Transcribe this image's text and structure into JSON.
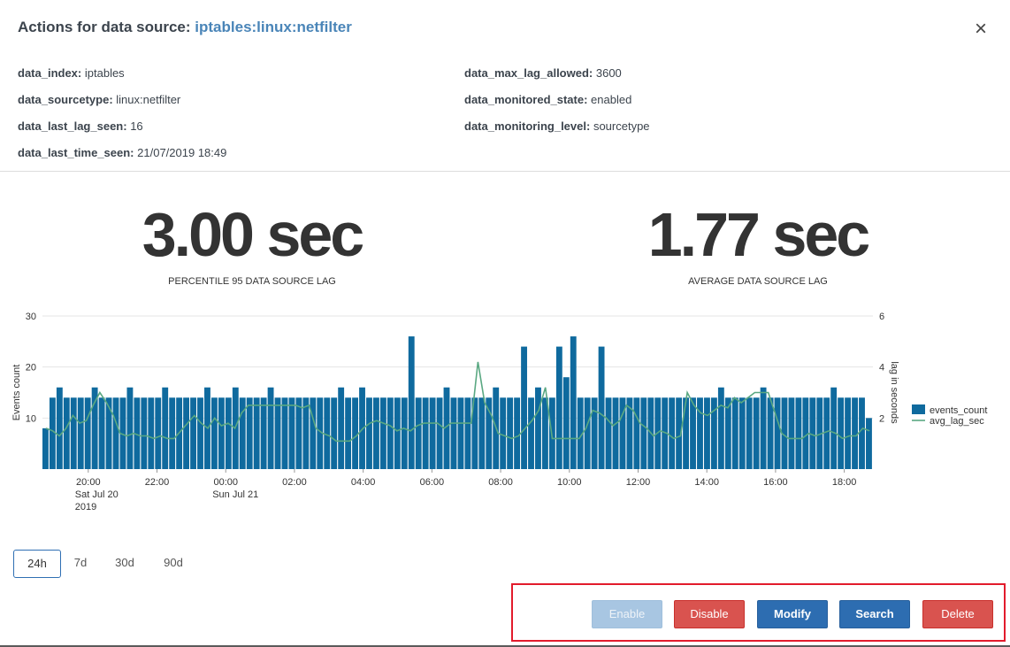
{
  "header": {
    "title_prefix": "Actions for data source:",
    "source_name": "iptables:linux:netfilter",
    "close_glyph": "×"
  },
  "details": {
    "left": [
      {
        "key": "data_index:",
        "value": "iptables"
      },
      {
        "key": "data_sourcetype:",
        "value": "linux:netfilter"
      },
      {
        "key": "data_last_lag_seen:",
        "value": "16"
      },
      {
        "key": "data_last_time_seen:",
        "value": "21/07/2019 18:49"
      }
    ],
    "right": [
      {
        "key": "data_max_lag_allowed:",
        "value": "3600"
      },
      {
        "key": "data_monitored_state:",
        "value": "enabled"
      },
      {
        "key": "data_monitoring_level:",
        "value": "sourcetype"
      }
    ]
  },
  "kpis": [
    {
      "value": "3.00 sec",
      "label": "PERCENTILE 95 DATA SOURCE LAG"
    },
    {
      "value": "1.77 sec",
      "label": "AVERAGE DATA SOURCE LAG"
    }
  ],
  "chart_data": {
    "type": "bar",
    "x_tick_labels": [
      [
        "20:00",
        "Sat Jul 20",
        "2019"
      ],
      [
        "22:00"
      ],
      [
        "00:00",
        "Sun Jul 21"
      ],
      [
        "02:00"
      ],
      [
        "04:00"
      ],
      [
        "06:00"
      ],
      [
        "08:00"
      ],
      [
        "10:00"
      ],
      [
        "12:00"
      ],
      [
        "14:00"
      ],
      [
        "16:00"
      ],
      [
        "18:00"
      ]
    ],
    "x_start": "2019-07-20 18:40",
    "x_end": "2019-07-21 18:50",
    "ylabel": "Events count",
    "y2label": "lag in seconds",
    "ylim": [
      0,
      30
    ],
    "y2lim": [
      0,
      6
    ],
    "yticks": [
      10,
      20,
      30
    ],
    "y2ticks": [
      2,
      4,
      6
    ],
    "grid": true,
    "legend_position": "right",
    "series": [
      {
        "name": "events_count",
        "type": "bar",
        "axis": "left",
        "color": "#0f6a9e",
        "values": [
          8,
          14,
          16,
          14,
          14,
          14,
          14,
          16,
          14,
          14,
          14,
          14,
          16,
          14,
          14,
          14,
          14,
          16,
          14,
          14,
          14,
          14,
          14,
          16,
          14,
          14,
          14,
          16,
          14,
          14,
          14,
          14,
          16,
          14,
          14,
          14,
          14,
          14,
          14,
          14,
          14,
          14,
          16,
          14,
          14,
          16,
          14,
          14,
          14,
          14,
          14,
          14,
          26,
          14,
          14,
          14,
          14,
          16,
          14,
          14,
          14,
          14,
          14,
          14,
          16,
          14,
          14,
          14,
          24,
          14,
          16,
          14,
          14,
          24,
          18,
          26,
          14,
          14,
          14,
          24,
          14,
          14,
          14,
          14,
          14,
          14,
          14,
          14,
          14,
          14,
          14,
          14,
          14,
          14,
          14,
          14,
          16,
          14,
          14,
          14,
          14,
          14,
          16,
          14,
          14,
          14,
          14,
          14,
          14,
          14,
          14,
          14,
          16,
          14,
          14,
          14,
          14,
          10
        ]
      },
      {
        "name": "avg_lag_sec",
        "type": "line",
        "axis": "right",
        "color": "#5aa882",
        "values": [
          1.6,
          1.5,
          1.3,
          1.6,
          2.1,
          1.8,
          1.9,
          2.5,
          3.0,
          2.6,
          2.1,
          1.4,
          1.3,
          1.4,
          1.3,
          1.3,
          1.2,
          1.3,
          1.2,
          1.2,
          1.5,
          1.8,
          2.1,
          1.8,
          1.6,
          2.0,
          1.7,
          1.8,
          1.6,
          2.2,
          2.5,
          2.5,
          2.5,
          2.5,
          2.5,
          2.5,
          2.5,
          2.5,
          2.4,
          2.5,
          1.6,
          1.4,
          1.3,
          1.1,
          1.1,
          1.1,
          1.3,
          1.6,
          1.8,
          1.9,
          1.8,
          1.7,
          1.5,
          1.6,
          1.5,
          1.7,
          1.8,
          1.8,
          1.8,
          1.6,
          1.8,
          1.8,
          1.8,
          1.8,
          4.2,
          2.6,
          2.1,
          1.4,
          1.3,
          1.2,
          1.3,
          1.6,
          1.9,
          2.3,
          3.2,
          1.2,
          1.2,
          1.2,
          1.2,
          1.2,
          1.6,
          2.3,
          2.2,
          2.0,
          1.7,
          1.9,
          2.5,
          2.3,
          1.8,
          1.6,
          1.3,
          1.5,
          1.4,
          1.2,
          1.3,
          3.0,
          2.5,
          2.2,
          2.1,
          2.3,
          2.5,
          2.4,
          2.8,
          2.6,
          2.8,
          3.0,
          3.0,
          3.0,
          2.2,
          1.4,
          1.2,
          1.2,
          1.2,
          1.4,
          1.3,
          1.4,
          1.5,
          1.4,
          1.2,
          1.3,
          1.3,
          1.6,
          1.5
        ]
      }
    ]
  },
  "time_ranges": [
    "24h",
    "7d",
    "30d",
    "90d"
  ],
  "selected_time_range": "24h",
  "actions": {
    "enable": "Enable",
    "disable": "Disable",
    "modify": "Modify",
    "search": "Search",
    "delete": "Delete"
  },
  "colors": {
    "source_link": "#4a85b8",
    "bar": "#0f6a9e",
    "lag_line": "#5aa882",
    "highlight_box": "#e21b2c",
    "danger": "#d9534f",
    "primary": "#2d6db1"
  }
}
